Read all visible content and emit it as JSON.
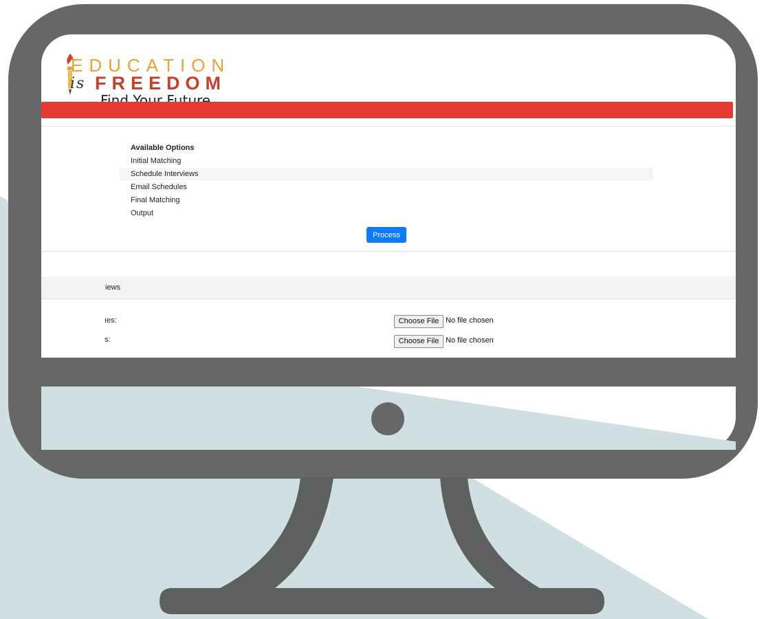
{
  "logo": {
    "line1": "EDUCATION",
    "is": "is",
    "line2": "FREEDOM",
    "tagline": "Find Your Future"
  },
  "options": {
    "heading": "Available Options",
    "items": [
      "Initial Matching",
      "Schedule Interviews",
      "Email Schedules",
      "Final Matching",
      "Output"
    ]
  },
  "process_label": "Process",
  "section": {
    "title": "iews",
    "rows": [
      {
        "label": "ıes:",
        "button": "Choose File",
        "status": "No file chosen"
      },
      {
        "label": "s:",
        "button": "Choose File",
        "status": "No file chosen"
      }
    ]
  },
  "colors": {
    "accent_red": "#e63b32",
    "button_blue": "#0d7bff",
    "monitor_gray": "#676767",
    "background_teal": "#d0e0e2"
  }
}
